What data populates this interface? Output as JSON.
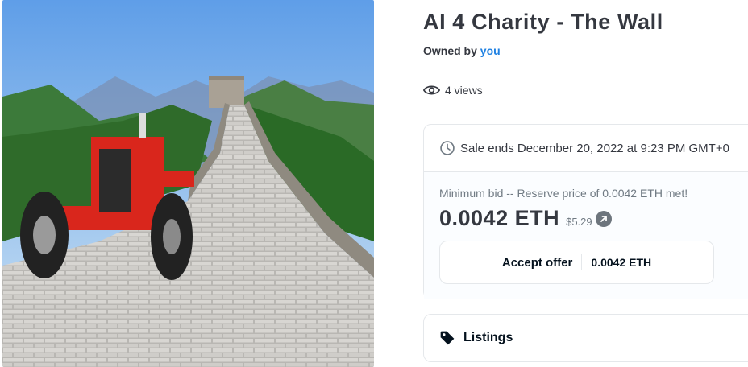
{
  "item": {
    "title": "AI 4 Charity - The Wall",
    "owned_prefix": "Owned by",
    "owner": "you",
    "views": "4 views"
  },
  "sale": {
    "ends_text": "Sale ends December 20, 2022 at 9:23 PM GMT+0",
    "min_bid_text": "Minimum bid -- Reserve price of 0.0042 ETH met!",
    "price": "0.0042 ETH",
    "usd": "$5.29",
    "accept_label": "Accept offer",
    "accept_amount": "0.0042 ETH"
  },
  "listings": {
    "label": "Listings"
  },
  "icons": {
    "views": "eye-icon",
    "sale": "clock-icon",
    "link": "arrow-up-right-icon",
    "listings": "tag-icon"
  },
  "colors": {
    "accent": "#2081e2",
    "tractor": "#d9261c",
    "text": "#353840",
    "muted": "#707a83"
  }
}
